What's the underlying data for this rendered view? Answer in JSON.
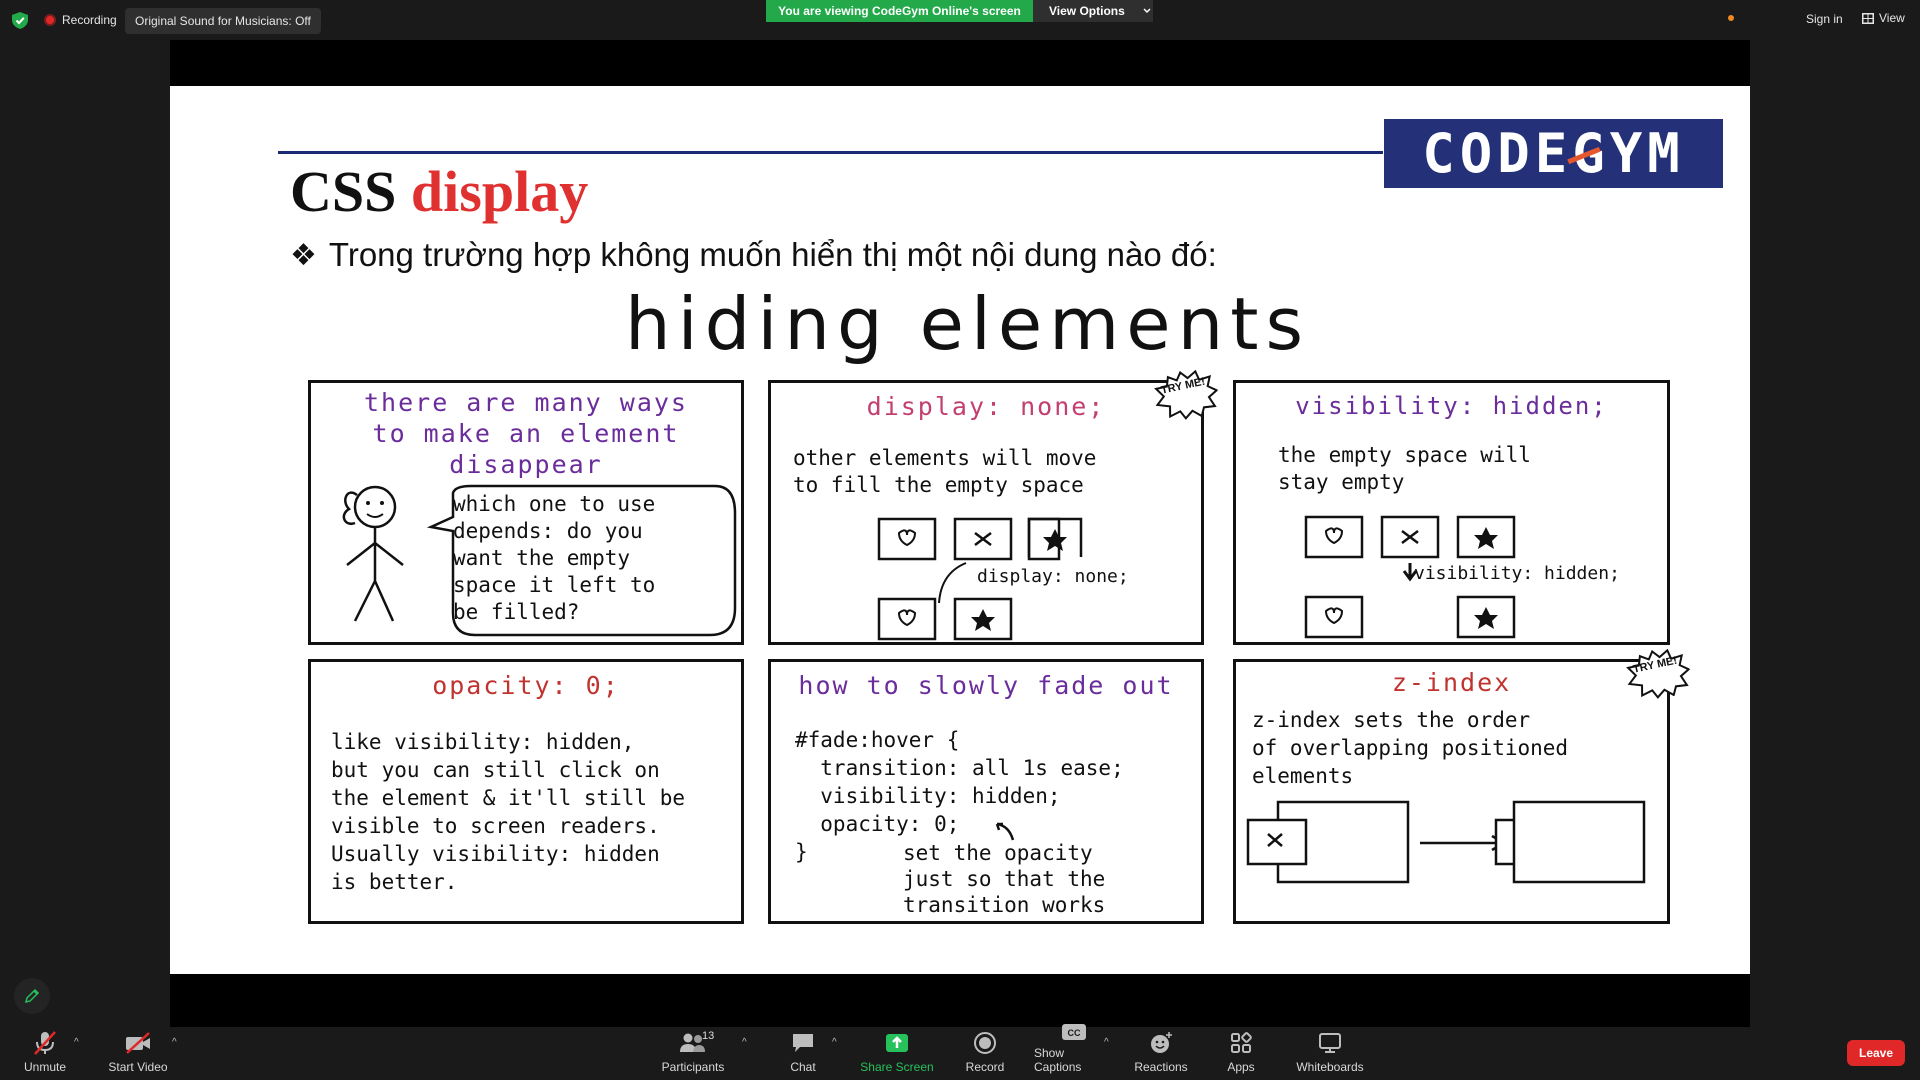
{
  "top_bar": {
    "recording_label": "Recording",
    "original_sound_label": "Original Sound for Musicians: Off",
    "viewing_banner": "You are viewing CodeGym Online's screen",
    "view_options_label": "View Options",
    "sign_in_label": "Sign in",
    "view_label": "View"
  },
  "slide": {
    "logo_text": "CODEGYM",
    "title_prefix": "CSS",
    "title_highlight": "display",
    "bullet_mark": "❖",
    "bullet_text": "Trong trường hợp không muốn hiển thị một nội dung nào đó:",
    "comic_title": "hiding elements",
    "panels": {
      "intro": {
        "title": "there are many ways\nto make an element\ndisappear",
        "bubble": "which one to use\ndepends: do you\nwant the empty\nspace it left to\nbe filled?"
      },
      "display_none": {
        "title": "display: none;",
        "badge": "TRY\nME!",
        "text": "other elements will move\nto fill the empty space",
        "annotation": "display: none;"
      },
      "visibility_hidden": {
        "title": "visibility: hidden;",
        "text": "the empty space will\nstay empty",
        "annotation": "visibility: hidden;"
      },
      "opacity": {
        "title": "opacity: 0;",
        "text": "like visibility: hidden,\nbut you can still click on\nthe element & it'll still be\nvisible to screen readers.\nUsually visibility: hidden\nis better."
      },
      "fade_out": {
        "title": "how to slowly fade out",
        "code": "#fade:hover {\n  transition: all 1s ease;\n  visibility: hidden;\n  opacity: 0;\n}",
        "note": "set the opacity\njust so that the\ntransition works"
      },
      "z_index": {
        "title": "z-index",
        "badge": "TRY\nME!",
        "text": "z-index sets the order\nof overlapping positioned\nelements"
      }
    }
  },
  "toolbar": {
    "unmute_label": "Unmute",
    "start_video_label": "Start Video",
    "participants_label": "Participants",
    "participants_count": "13",
    "chat_label": "Chat",
    "share_screen_label": "Share Screen",
    "record_label": "Record",
    "show_captions_label": "Show Captions",
    "reactions_label": "Reactions",
    "apps_label": "Apps",
    "whiteboards_label": "Whiteboards",
    "leave_label": "Leave"
  },
  "colors": {
    "green_banner": "#23a94a",
    "leave_red": "#e02828",
    "logo_blue": "#243178",
    "title_red": "#e03131"
  }
}
